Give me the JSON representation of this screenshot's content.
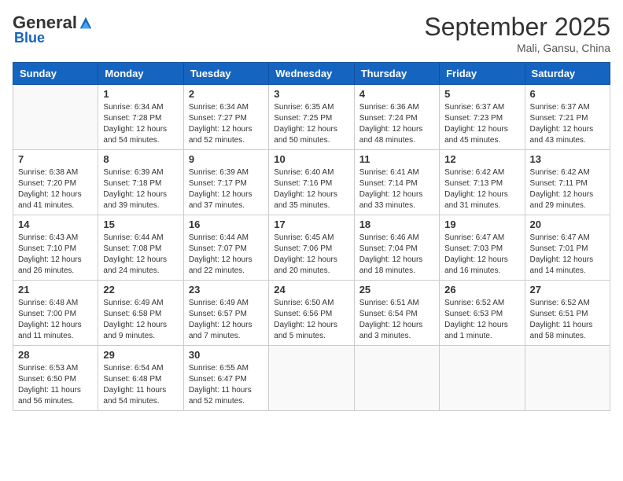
{
  "header": {
    "logo_general": "General",
    "logo_blue": "Blue",
    "month_title": "September 2025",
    "subtitle": "Mali, Gansu, China"
  },
  "days_of_week": [
    "Sunday",
    "Monday",
    "Tuesday",
    "Wednesday",
    "Thursday",
    "Friday",
    "Saturday"
  ],
  "weeks": [
    [
      {
        "day": "",
        "lines": []
      },
      {
        "day": "1",
        "lines": [
          "Sunrise: 6:34 AM",
          "Sunset: 7:28 PM",
          "Daylight: 12 hours",
          "and 54 minutes."
        ]
      },
      {
        "day": "2",
        "lines": [
          "Sunrise: 6:34 AM",
          "Sunset: 7:27 PM",
          "Daylight: 12 hours",
          "and 52 minutes."
        ]
      },
      {
        "day": "3",
        "lines": [
          "Sunrise: 6:35 AM",
          "Sunset: 7:25 PM",
          "Daylight: 12 hours",
          "and 50 minutes."
        ]
      },
      {
        "day": "4",
        "lines": [
          "Sunrise: 6:36 AM",
          "Sunset: 7:24 PM",
          "Daylight: 12 hours",
          "and 48 minutes."
        ]
      },
      {
        "day": "5",
        "lines": [
          "Sunrise: 6:37 AM",
          "Sunset: 7:23 PM",
          "Daylight: 12 hours",
          "and 45 minutes."
        ]
      },
      {
        "day": "6",
        "lines": [
          "Sunrise: 6:37 AM",
          "Sunset: 7:21 PM",
          "Daylight: 12 hours",
          "and 43 minutes."
        ]
      }
    ],
    [
      {
        "day": "7",
        "lines": [
          "Sunrise: 6:38 AM",
          "Sunset: 7:20 PM",
          "Daylight: 12 hours",
          "and 41 minutes."
        ]
      },
      {
        "day": "8",
        "lines": [
          "Sunrise: 6:39 AM",
          "Sunset: 7:18 PM",
          "Daylight: 12 hours",
          "and 39 minutes."
        ]
      },
      {
        "day": "9",
        "lines": [
          "Sunrise: 6:39 AM",
          "Sunset: 7:17 PM",
          "Daylight: 12 hours",
          "and 37 minutes."
        ]
      },
      {
        "day": "10",
        "lines": [
          "Sunrise: 6:40 AM",
          "Sunset: 7:16 PM",
          "Daylight: 12 hours",
          "and 35 minutes."
        ]
      },
      {
        "day": "11",
        "lines": [
          "Sunrise: 6:41 AM",
          "Sunset: 7:14 PM",
          "Daylight: 12 hours",
          "and 33 minutes."
        ]
      },
      {
        "day": "12",
        "lines": [
          "Sunrise: 6:42 AM",
          "Sunset: 7:13 PM",
          "Daylight: 12 hours",
          "and 31 minutes."
        ]
      },
      {
        "day": "13",
        "lines": [
          "Sunrise: 6:42 AM",
          "Sunset: 7:11 PM",
          "Daylight: 12 hours",
          "and 29 minutes."
        ]
      }
    ],
    [
      {
        "day": "14",
        "lines": [
          "Sunrise: 6:43 AM",
          "Sunset: 7:10 PM",
          "Daylight: 12 hours",
          "and 26 minutes."
        ]
      },
      {
        "day": "15",
        "lines": [
          "Sunrise: 6:44 AM",
          "Sunset: 7:08 PM",
          "Daylight: 12 hours",
          "and 24 minutes."
        ]
      },
      {
        "day": "16",
        "lines": [
          "Sunrise: 6:44 AM",
          "Sunset: 7:07 PM",
          "Daylight: 12 hours",
          "and 22 minutes."
        ]
      },
      {
        "day": "17",
        "lines": [
          "Sunrise: 6:45 AM",
          "Sunset: 7:06 PM",
          "Daylight: 12 hours",
          "and 20 minutes."
        ]
      },
      {
        "day": "18",
        "lines": [
          "Sunrise: 6:46 AM",
          "Sunset: 7:04 PM",
          "Daylight: 12 hours",
          "and 18 minutes."
        ]
      },
      {
        "day": "19",
        "lines": [
          "Sunrise: 6:47 AM",
          "Sunset: 7:03 PM",
          "Daylight: 12 hours",
          "and 16 minutes."
        ]
      },
      {
        "day": "20",
        "lines": [
          "Sunrise: 6:47 AM",
          "Sunset: 7:01 PM",
          "Daylight: 12 hours",
          "and 14 minutes."
        ]
      }
    ],
    [
      {
        "day": "21",
        "lines": [
          "Sunrise: 6:48 AM",
          "Sunset: 7:00 PM",
          "Daylight: 12 hours",
          "and 11 minutes."
        ]
      },
      {
        "day": "22",
        "lines": [
          "Sunrise: 6:49 AM",
          "Sunset: 6:58 PM",
          "Daylight: 12 hours",
          "and 9 minutes."
        ]
      },
      {
        "day": "23",
        "lines": [
          "Sunrise: 6:49 AM",
          "Sunset: 6:57 PM",
          "Daylight: 12 hours",
          "and 7 minutes."
        ]
      },
      {
        "day": "24",
        "lines": [
          "Sunrise: 6:50 AM",
          "Sunset: 6:56 PM",
          "Daylight: 12 hours",
          "and 5 minutes."
        ]
      },
      {
        "day": "25",
        "lines": [
          "Sunrise: 6:51 AM",
          "Sunset: 6:54 PM",
          "Daylight: 12 hours",
          "and 3 minutes."
        ]
      },
      {
        "day": "26",
        "lines": [
          "Sunrise: 6:52 AM",
          "Sunset: 6:53 PM",
          "Daylight: 12 hours",
          "and 1 minute."
        ]
      },
      {
        "day": "27",
        "lines": [
          "Sunrise: 6:52 AM",
          "Sunset: 6:51 PM",
          "Daylight: 11 hours",
          "and 58 minutes."
        ]
      }
    ],
    [
      {
        "day": "28",
        "lines": [
          "Sunrise: 6:53 AM",
          "Sunset: 6:50 PM",
          "Daylight: 11 hours",
          "and 56 minutes."
        ]
      },
      {
        "day": "29",
        "lines": [
          "Sunrise: 6:54 AM",
          "Sunset: 6:48 PM",
          "Daylight: 11 hours",
          "and 54 minutes."
        ]
      },
      {
        "day": "30",
        "lines": [
          "Sunrise: 6:55 AM",
          "Sunset: 6:47 PM",
          "Daylight: 11 hours",
          "and 52 minutes."
        ]
      },
      {
        "day": "",
        "lines": []
      },
      {
        "day": "",
        "lines": []
      },
      {
        "day": "",
        "lines": []
      },
      {
        "day": "",
        "lines": []
      }
    ]
  ]
}
